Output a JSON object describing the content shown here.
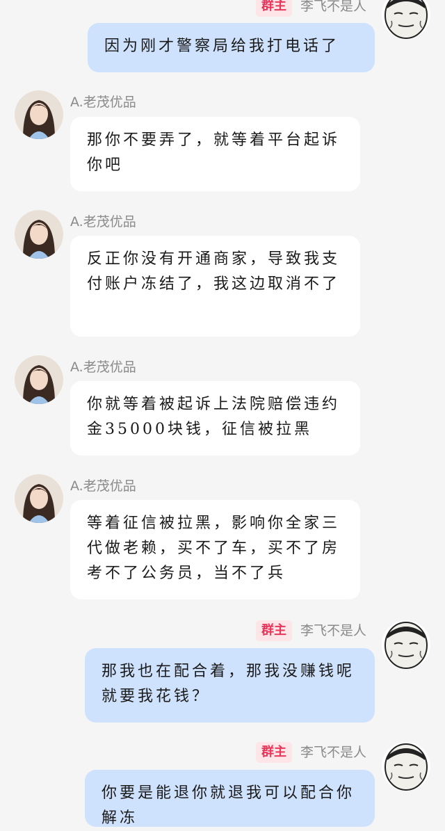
{
  "members": {
    "self_name": "李飞不是人",
    "self_badge": "群主",
    "other_name": "A.老茂优品"
  },
  "messages": [
    {
      "sender": "self",
      "text": "因为刚才警察局给我打电话了",
      "show_header": false
    },
    {
      "sender": "other",
      "text": "那你不要弄了，就等着平台起诉你吧"
    },
    {
      "sender": "other",
      "text": "反正你没有开通商家，导致我支付账户冻结了，我这边取消不了"
    },
    {
      "sender": "other",
      "text": "你就等着被起诉上法院赔偿违约金35000块钱，征信被拉黑"
    },
    {
      "sender": "other",
      "text": "等着征信被拉黑，影响你全家三代做老赖，买不了车，买不了房考不了公务员，当不了兵"
    },
    {
      "sender": "self",
      "text": "那我也在配合着，那我没赚钱呢就要我花钱？",
      "show_header": true
    },
    {
      "sender": "self",
      "text": "你要是能退你就退我可以配合你解冻",
      "show_header": true
    }
  ],
  "colors": {
    "background": "#f5f5f5",
    "incoming_bubble": "#ffffff",
    "outgoing_bubble": "#cfe2fd",
    "badge_bg": "#fde5e8",
    "badge_text": "#e8355a",
    "name_text": "#8a8a8a"
  },
  "icons": {
    "other_avatar": "girl-photo-avatar",
    "self_avatar": "meme-face-avatar"
  }
}
